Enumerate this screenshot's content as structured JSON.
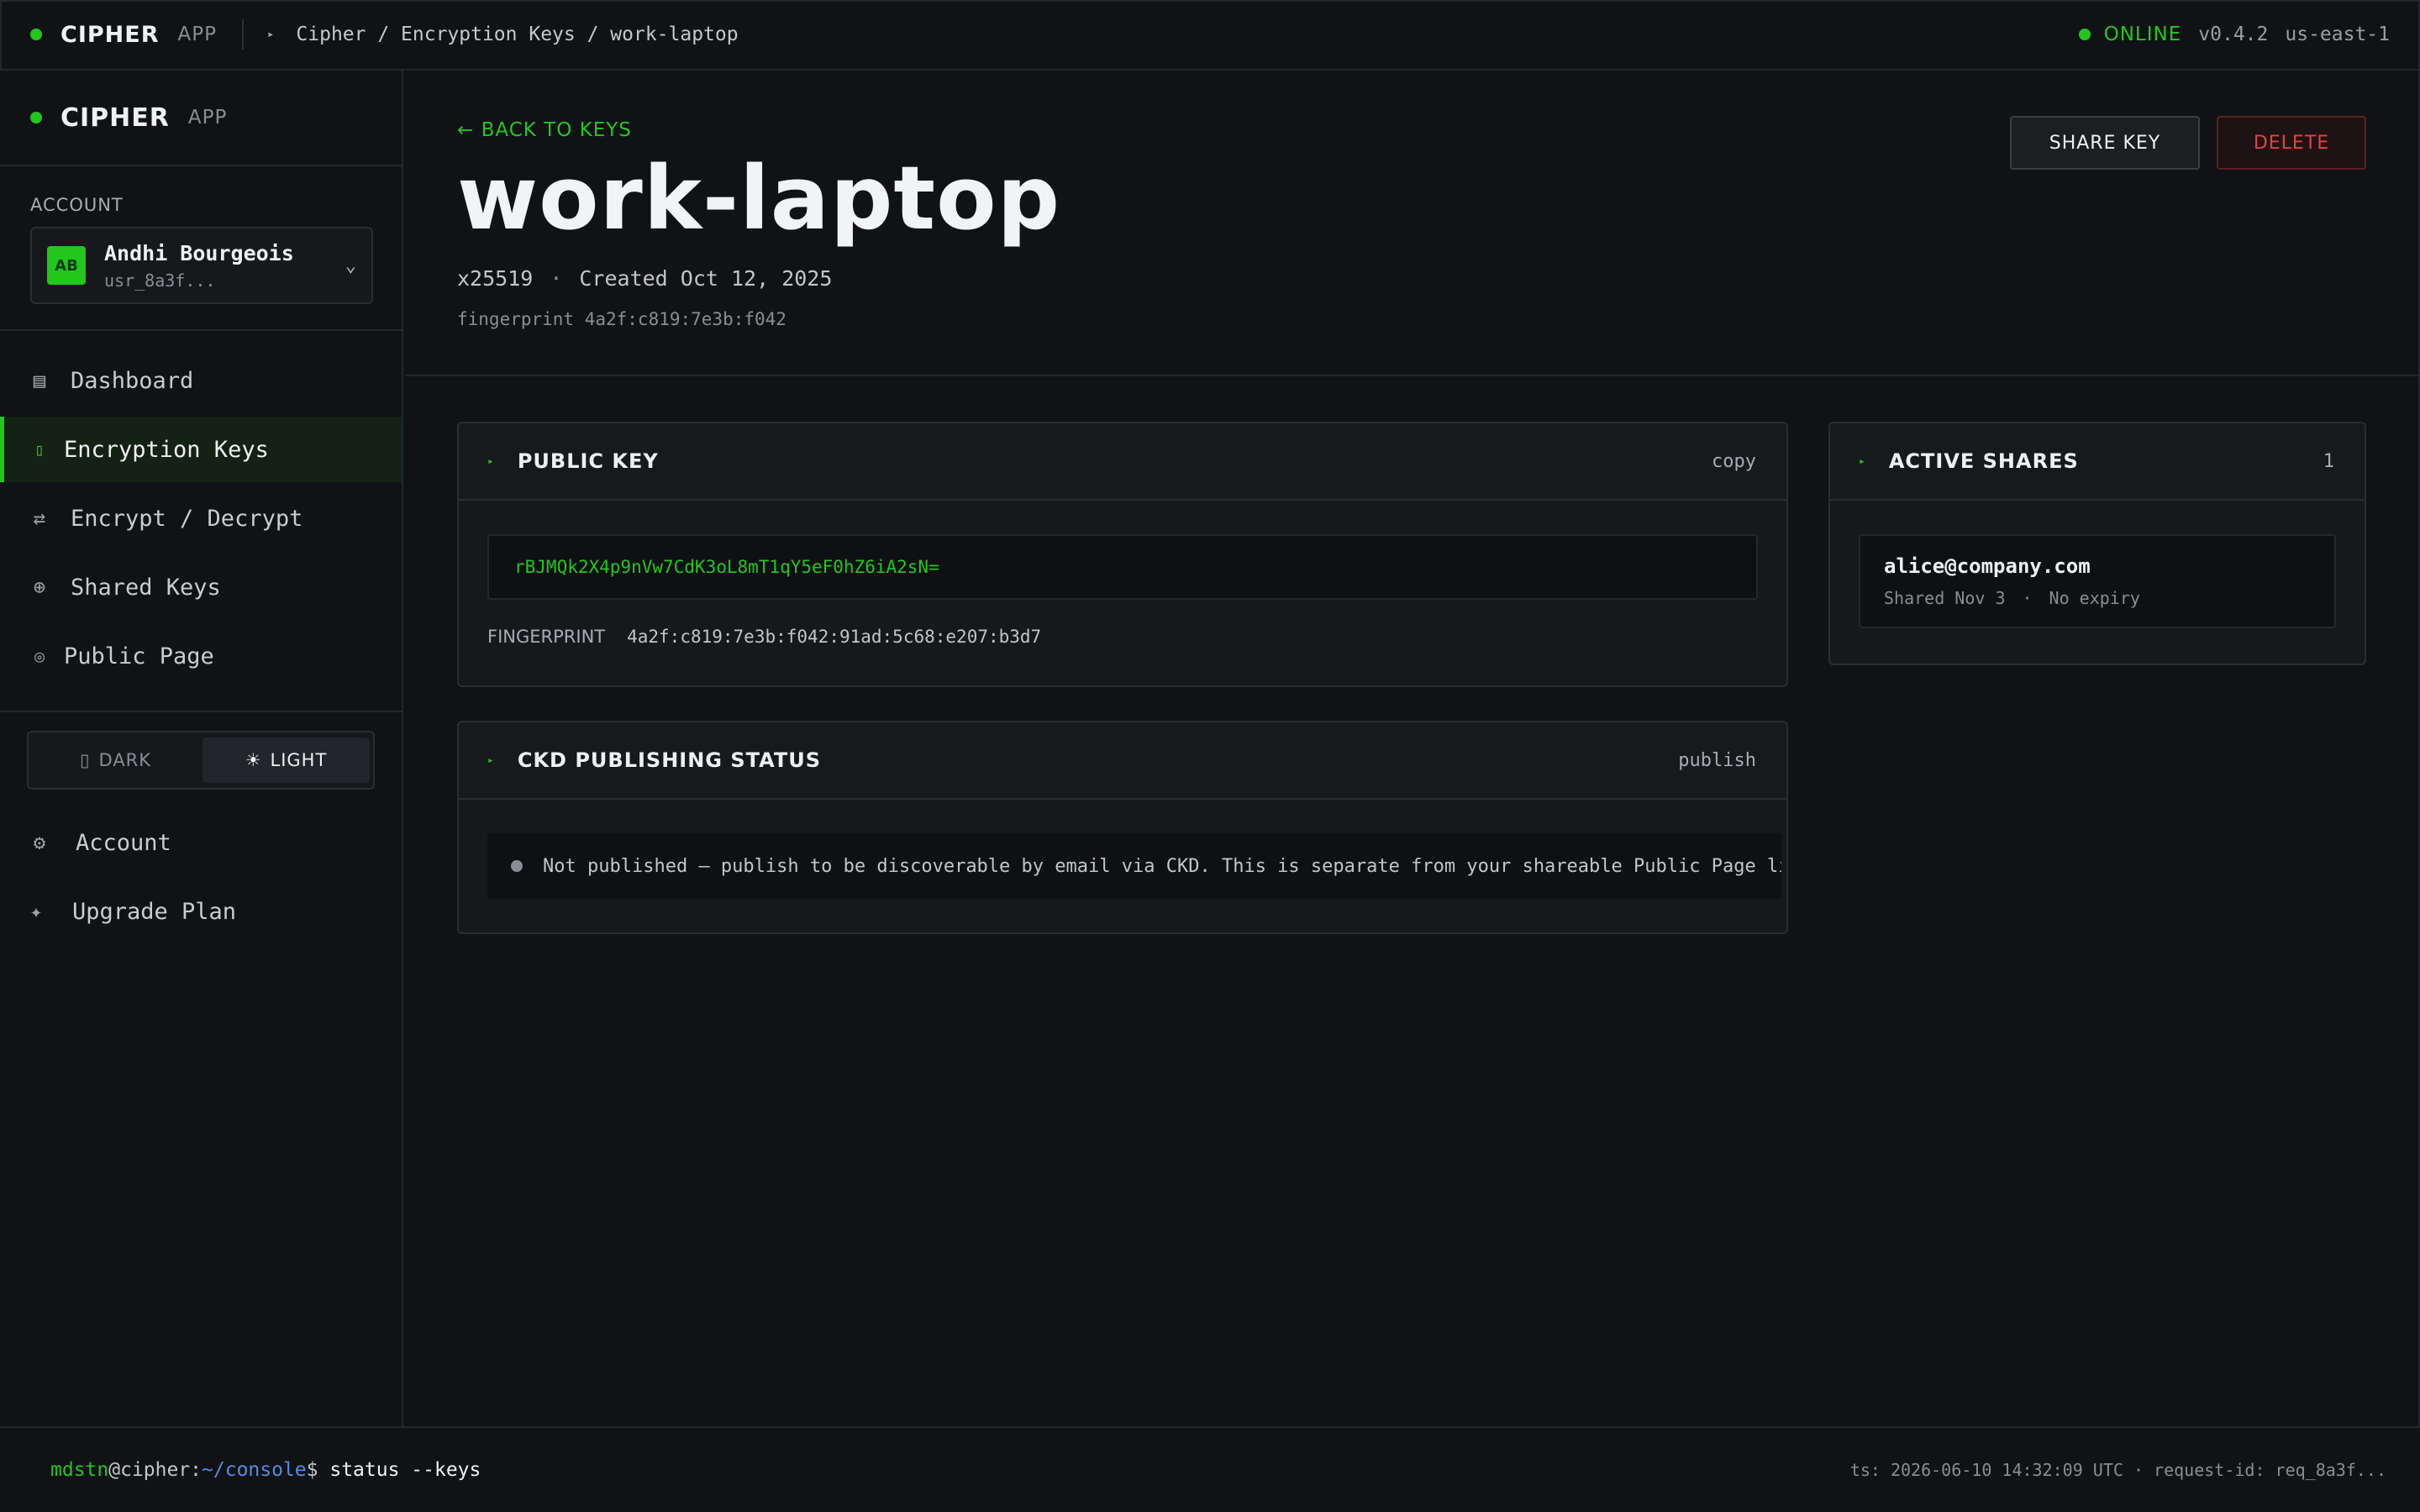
{
  "topbar": {
    "brand": "CIPHER",
    "brand_sub": "APP",
    "breadcrumb": "Cipher / Encryption Keys / work-laptop",
    "status": "ONLINE",
    "version": "v0.4.2",
    "region": "us-east-1"
  },
  "sidebar": {
    "brand": "CIPHER",
    "brand_sub": "APP",
    "account_label": "ACCOUNT",
    "account": {
      "initials": "AB",
      "name": "Andhi Bourgeois",
      "id": "usr_8a3f..."
    },
    "nav": [
      {
        "label": "Dashboard",
        "icon": "grid-icon"
      },
      {
        "label": "Encryption Keys",
        "icon": "key-icon",
        "active": true
      },
      {
        "label": "Encrypt / Decrypt",
        "icon": "swap-icon"
      },
      {
        "label": "Shared Keys",
        "icon": "share-icon"
      },
      {
        "label": "Public Page",
        "icon": "globe-icon"
      }
    ],
    "theme": {
      "dark": "DARK",
      "light": "LIGHT",
      "selected": "light"
    },
    "bottom_nav": [
      {
        "label": "Account",
        "icon": "gear-icon"
      },
      {
        "label": "Upgrade Plan",
        "icon": "sparkle-icon"
      }
    ]
  },
  "header": {
    "back": "← BACK TO KEYS",
    "title": "work-laptop",
    "algorithm": "x25519",
    "created": "Created Oct 12, 2025",
    "fingerprint_short": "fingerprint 4a2f:c819:7e3b:f042",
    "share_button": "SHARE KEY",
    "delete_button": "DELETE"
  },
  "public_key": {
    "title": "PUBLIC KEY",
    "action": "copy",
    "value": "rBJMQk2X4p9nVw7CdK3oL8mT1qY5eF0hZ6iA2sN=",
    "fingerprint_label": "FINGERPRINT",
    "fingerprint": "4a2f:c819:7e3b:f042:91ad:5c68:e207:b3d7"
  },
  "ckd": {
    "title": "CKD PUBLISHING STATUS",
    "action": "publish",
    "message": "Not published — publish to be discoverable by email via CKD. This is separate from your shareable Public Page link."
  },
  "shares": {
    "title": "ACTIVE SHARES",
    "count": "1",
    "items": [
      {
        "email": "alice@company.com",
        "shared": "Shared Nov 3",
        "expiry": "No expiry"
      }
    ]
  },
  "footer": {
    "user": "mdstn",
    "host": "@cipher:",
    "path": "~/console",
    "prompt_symbol": "$ ",
    "command": "status --keys",
    "info": "ts: 2026-06-10 14:32:09 UTC · request-id: req_8a3f..."
  },
  "colors": {
    "accent": "#22c71e",
    "danger": "#e0433f",
    "background": "#111215",
    "panel": "#16181c"
  }
}
